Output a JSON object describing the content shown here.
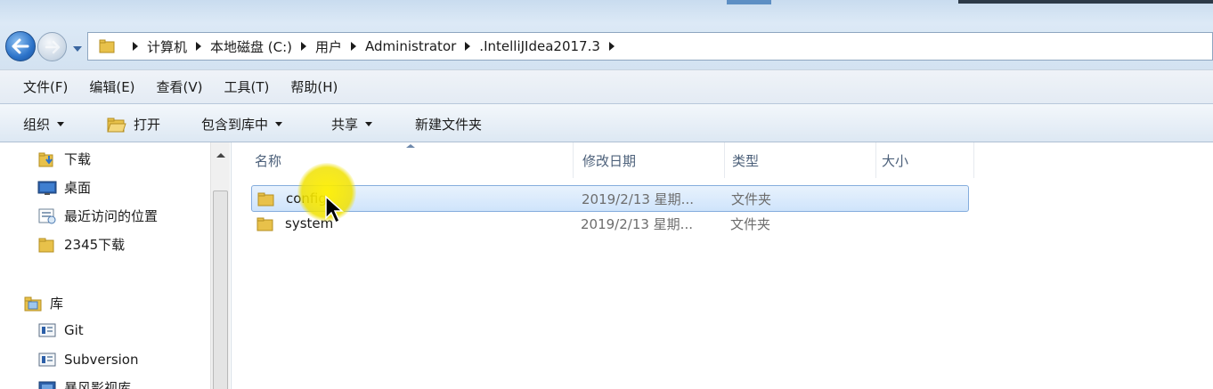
{
  "window": {
    "title_strip": true
  },
  "address": {
    "crumbs": [
      {
        "label": "计算机"
      },
      {
        "label": "本地磁盘 (C:)"
      },
      {
        "label": "用户"
      },
      {
        "label": "Administrator"
      },
      {
        "label": ".IntelliJIdea2017.3"
      }
    ]
  },
  "menubar": {
    "items": [
      "文件(F)",
      "编辑(E)",
      "查看(V)",
      "工具(T)",
      "帮助(H)"
    ]
  },
  "toolbar": {
    "organize": "组织",
    "open": "打开",
    "include_library": "包含到库中",
    "share": "共享",
    "new_folder": "新建文件夹"
  },
  "navpane": {
    "items": [
      {
        "label": "下载",
        "icon": "download-folder-icon"
      },
      {
        "label": "桌面",
        "icon": "desktop-icon"
      },
      {
        "label": "最近访问的位置",
        "icon": "recent-places-icon"
      },
      {
        "label": "2345下载",
        "icon": "folder-icon"
      },
      {
        "label": "库",
        "icon": "library-icon"
      },
      {
        "label": "Git",
        "icon": "library-doc-icon"
      },
      {
        "label": "Subversion",
        "icon": "library-doc-icon"
      },
      {
        "label": "暴风影视库",
        "icon": "library-video-icon"
      }
    ]
  },
  "filelist": {
    "columns": [
      "名称",
      "修改日期",
      "类型",
      "大小"
    ],
    "rows": [
      {
        "name": "config",
        "date": "2019/2/13 星期...",
        "type": "文件夹",
        "size": "",
        "selected": true
      },
      {
        "name": "system",
        "date": "2019/2/13 星期...",
        "type": "文件夹",
        "size": "",
        "selected": false
      }
    ]
  },
  "colors": {
    "selection_fill": "#cfe4fb",
    "selection_border": "#84acdd",
    "folder_yellow": "#e8c14a",
    "cursor_highlight": "#f0e100"
  }
}
